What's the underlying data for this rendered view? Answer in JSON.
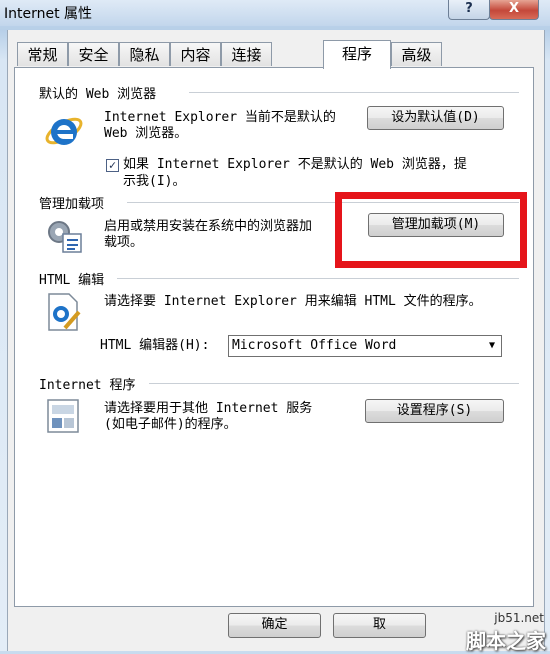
{
  "window": {
    "title": "Internet 属性",
    "help_label": "?",
    "close_label": "X"
  },
  "tabs": [
    {
      "label": "常规"
    },
    {
      "label": "安全"
    },
    {
      "label": "隐私"
    },
    {
      "label": "内容"
    },
    {
      "label": "连接"
    },
    {
      "label": "程序"
    },
    {
      "label": "高级"
    }
  ],
  "default_browser": {
    "header": "默认的 Web 浏览器",
    "text_line1": "Internet Explorer 当前不是默认的",
    "text_line2": "Web 浏览器。",
    "button_label": "设为默认值(D)",
    "checkbox_checked": true,
    "checkbox_line1": "如果 Internet Explorer 不是默认的 Web 浏览器，提",
    "checkbox_line2": "示我(I)。"
  },
  "addons": {
    "header": "管理加载项",
    "text_line1": "启用或禁用安装在系统中的浏览器加",
    "text_line2": "载项。",
    "button_label": "管理加载项(M)"
  },
  "html_editing": {
    "header": "HTML 编辑",
    "text": "请选择要 Internet Explorer 用来编辑 HTML 文件的程序。",
    "editor_label": "HTML 编辑器(H):",
    "editor_value": "Microsoft Office Word"
  },
  "internet_programs": {
    "header": "Internet 程序",
    "text_line1": "请选择要用于其他 Internet 服务",
    "text_line2": "(如电子邮件)的程序。",
    "button_label": "设置程序(S)"
  },
  "footer": {
    "ok_label": "确定",
    "cancel_label": "取"
  },
  "watermark": {
    "url": "jb51.net",
    "name": "脚本之家"
  },
  "colors": {
    "highlight": "#e5141a",
    "ie_blue": "#1e73c8",
    "accent_gold": "#e8b32c"
  },
  "icons": {
    "ie": "internet-explorer-icon",
    "addons": "addons-gear-icon",
    "html": "html-editor-icon",
    "programs": "programs-icon"
  }
}
